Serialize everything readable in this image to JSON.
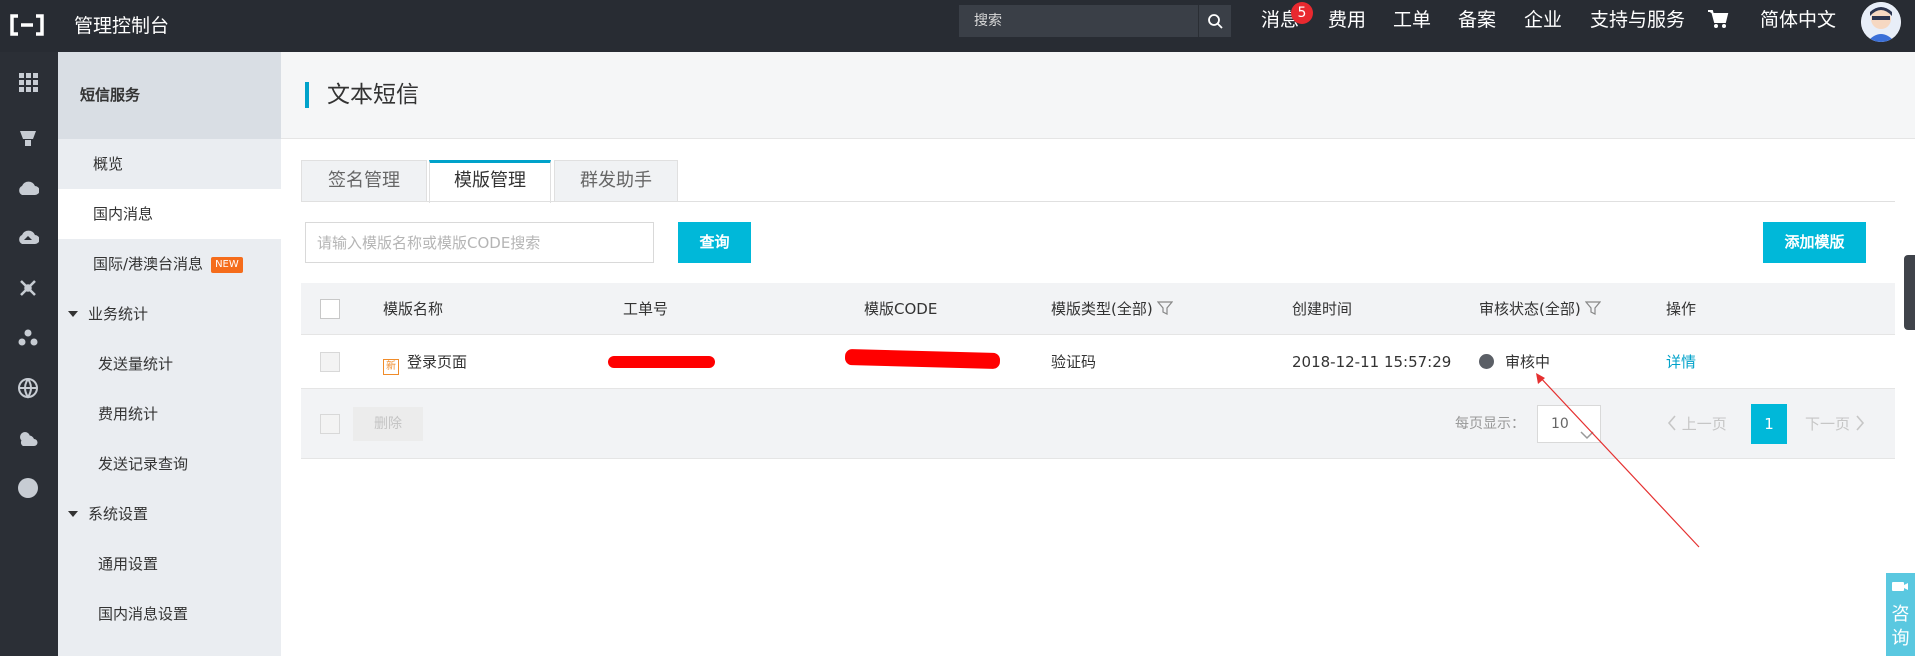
{
  "topbar": {
    "title": "管理控制台",
    "search_placeholder": "搜索",
    "nav": {
      "messages": "消息",
      "messages_badge": "5",
      "billing": "费用",
      "tickets": "工单",
      "icp": "备案",
      "enterprise": "企业",
      "support": "支持与服务",
      "language": "简体中文"
    }
  },
  "sidebar": {
    "header": "短信服务",
    "items": [
      {
        "label": "概览"
      },
      {
        "label": "国内消息"
      },
      {
        "label": "国际/港澳台消息",
        "badge": "NEW"
      },
      {
        "label": "业务统计"
      },
      {
        "label": "发送量统计"
      },
      {
        "label": "费用统计"
      },
      {
        "label": "发送记录查询"
      },
      {
        "label": "系统设置"
      },
      {
        "label": "通用设置"
      },
      {
        "label": "国内消息设置"
      }
    ]
  },
  "main": {
    "title": "文本短信",
    "tabs": [
      {
        "label": "签名管理"
      },
      {
        "label": "模版管理"
      },
      {
        "label": "群发助手"
      }
    ],
    "search_placeholder": "请输入模版名称或模版CODE搜索",
    "query_label": "查询",
    "add_template_label": "添加模版",
    "table": {
      "headers": [
        "模版名称",
        "工单号",
        "模版CODE",
        "模版类型(全部)",
        "创建时间",
        "审核状态(全部)",
        "操作"
      ],
      "rows": [
        {
          "icon_text": "新",
          "name": "登录页面",
          "type": "验证码",
          "created": "2018-12-11 15:57:29",
          "status": "审核中",
          "action": "详情"
        }
      ]
    },
    "footer": {
      "delete_label": "删除",
      "page_size_label": "每页显示：",
      "page_size": "10",
      "prev_label": "上一页",
      "current_page": "1",
      "next_label": "下一页"
    }
  },
  "consult_label": "咨询",
  "colors": {
    "accent": "#00b8d9",
    "topbar_bg": "#282c33",
    "redaction": "#ff0000"
  }
}
